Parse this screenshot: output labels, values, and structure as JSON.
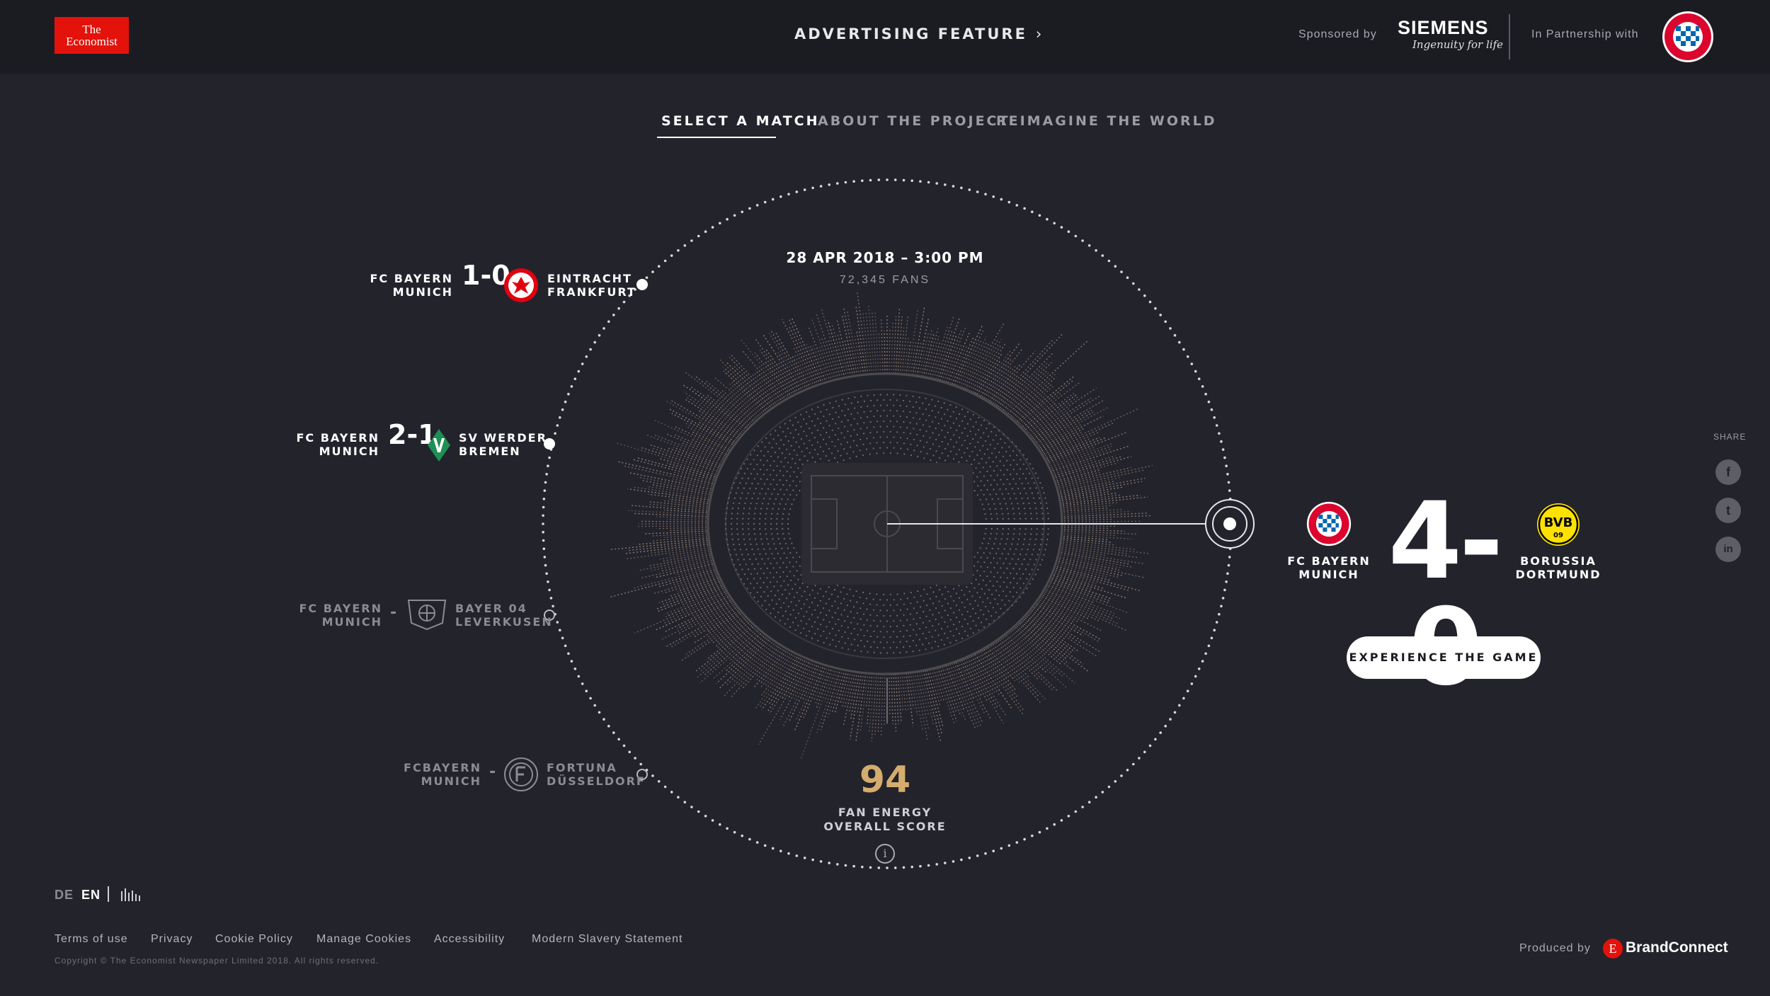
{
  "header": {
    "logo_line1": "The",
    "logo_line2": "Economist",
    "advertising_feature": "ADVERTISING FEATURE",
    "sponsored_by": "Sponsored by",
    "sponsor_name": "SIEMENS",
    "sponsor_tagline": "Ingenuity for life",
    "partnership": "In Partnership with"
  },
  "nav": {
    "tabs": [
      {
        "label": "SELECT A MATCH",
        "active": true
      },
      {
        "label": "ABOUT THE PROJECT",
        "active": false
      },
      {
        "label": "REIMAGINE THE WORLD",
        "active": false
      }
    ]
  },
  "matches": [
    {
      "home_line1": "FC BAYERN",
      "home_line2": "MUNICH",
      "score": "1-0",
      "away_line1": "EINTRACHT",
      "away_line2": "FRANKFURT",
      "played": true
    },
    {
      "home_line1": "FC BAYERN",
      "home_line2": "MUNICH",
      "score": "2-1",
      "away_line1": "SV WERDER",
      "away_line2": "BREMEN",
      "played": true
    },
    {
      "home_line1": "FC BAYERN",
      "home_line2": "MUNICH",
      "score": "-",
      "away_line1": "BAYER 04",
      "away_line2": "LEVERKUSEN",
      "played": false
    },
    {
      "home_line1": "FCBAYERN",
      "home_line2": "MUNICH",
      "score": "-",
      "away_line1": "FORTUNA",
      "away_line2": "DÜSSELDORF",
      "played": false
    }
  ],
  "selected": {
    "date": "28 APR 2018 – 3:00 PM",
    "fans": "72,345 FANS",
    "home_line1": "FC BAYERN",
    "home_line2": "MUNICH",
    "away_line1": "BORUSSIA",
    "away_line2": "DORTMUND",
    "score": "4-0",
    "away_crest_text": "BVB",
    "away_crest_year": "09",
    "cta": "EXPERIENCE THE GAME",
    "fan_energy": "94",
    "fan_energy_line1": "FAN ENERGY",
    "fan_energy_line2": "OVERALL SCORE"
  },
  "share": {
    "label": "SHARE",
    "facebook_glyph": "f",
    "twitter_glyph": "t",
    "linkedin_glyph": "in"
  },
  "footer": {
    "lang_de": "DE",
    "lang_en": "EN",
    "links": [
      "Terms of use",
      "Privacy",
      "Cookie Policy",
      "Manage Cookies",
      "Accessibility",
      "Modern Slavery Statement"
    ],
    "copyright": "Copyright © The Economist Newspaper Limited 2018. All rights reserved.",
    "produced_by": "Produced by",
    "brand_letter": "E",
    "brand": "BrandConnect"
  },
  "colors": {
    "background": "#23232c",
    "header": "#1b1b22",
    "energy": "#d4ac6e",
    "economist_red": "#e3120b",
    "bayern_red": "#dc052d",
    "bayern_blue": "#0066b2",
    "dortmund_yellow": "#fde100",
    "werder_green": "#1d9053"
  }
}
